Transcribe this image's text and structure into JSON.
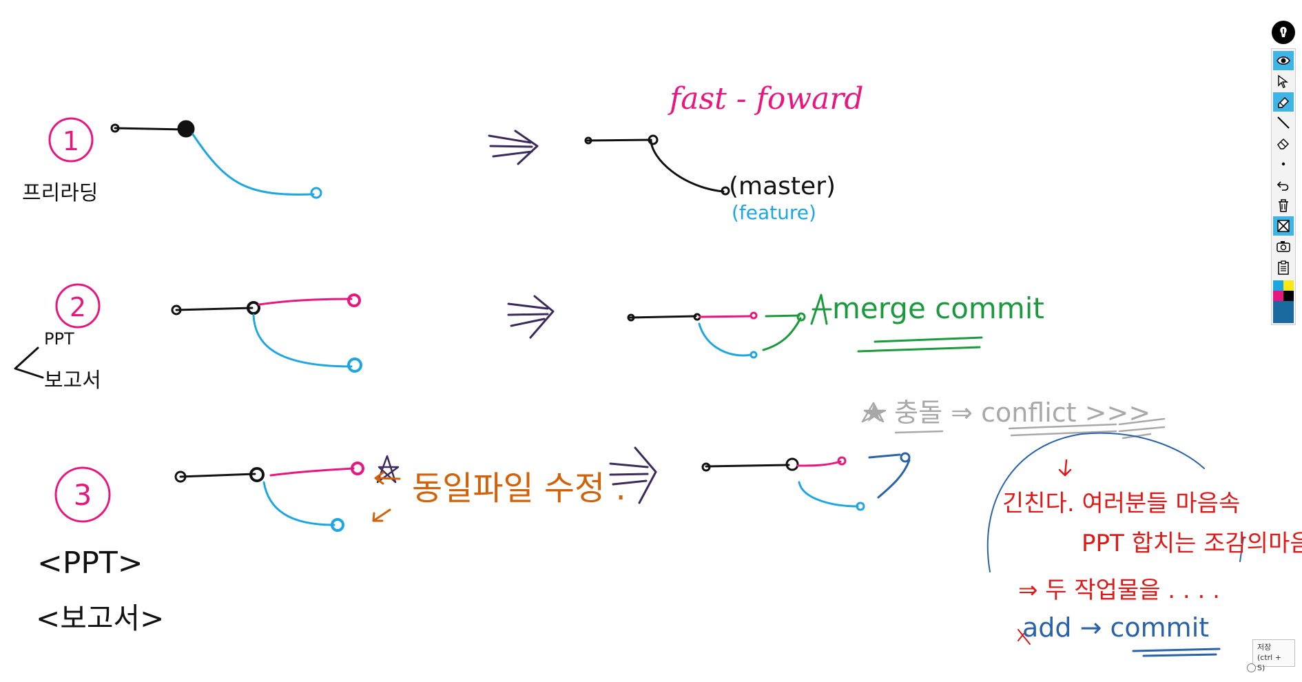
{
  "colors": {
    "ink_black": "#111111",
    "ink_pink": "#e8177f",
    "ink_blue": "#1ea6e0",
    "ink_green": "#1a9a3c",
    "ink_orange": "#d2620a",
    "ink_red": "#e01818",
    "ink_navy": "#2a62a8",
    "ink_gray": "#a8a8a8",
    "ink_purple": "#3d2a5c",
    "toolbar_active": "#3fb4e5",
    "swatch_cyan": "#1aa6e0",
    "swatch_yellow": "#f8e816",
    "swatch_pink": "#e8177f",
    "swatch_black": "#000000",
    "swatch_navy": "#1a6aa0"
  },
  "board": {
    "case1": {
      "number": "1",
      "label": "프리라딩",
      "title": "fast - foward",
      "tag_master": "(master)",
      "tag_feature": "(feature)"
    },
    "case2": {
      "number": "2",
      "note_top": "PPT",
      "note_bottom": "보고서",
      "caption": "merge commit"
    },
    "case3": {
      "number": "3",
      "label_ppt": "<PPT>",
      "label_report": "<보고서>",
      "caption": "동일파일 수정 .",
      "conflict_line": "★ 충돌 ⇒ conflict >>>",
      "note_line1": "긴친다. 여러분들 마음속",
      "note_line2": "PPT 합치는 조감의마음 -",
      "note_line3": "⇒ 두 작업물을 . . . .",
      "note_line4": "add → commit"
    }
  },
  "toolbar": {
    "logo_icon": "pen-logo-icon",
    "tools": [
      {
        "name": "eye-icon",
        "active": true
      },
      {
        "name": "cursor-icon",
        "active": false
      },
      {
        "name": "pen-icon",
        "active": true
      },
      {
        "name": "line-icon",
        "active": false
      },
      {
        "name": "eraser-icon",
        "active": false
      },
      {
        "name": "dot-icon",
        "active": false
      },
      {
        "name": "undo-icon",
        "active": false
      },
      {
        "name": "trash-icon",
        "active": false
      },
      {
        "name": "clear-all-icon",
        "active": true
      },
      {
        "name": "camera-icon",
        "active": false
      },
      {
        "name": "clipboard-icon",
        "active": false
      }
    ]
  },
  "save_tooltip": {
    "line1": "저장",
    "line2": "(ctrl + S)"
  }
}
